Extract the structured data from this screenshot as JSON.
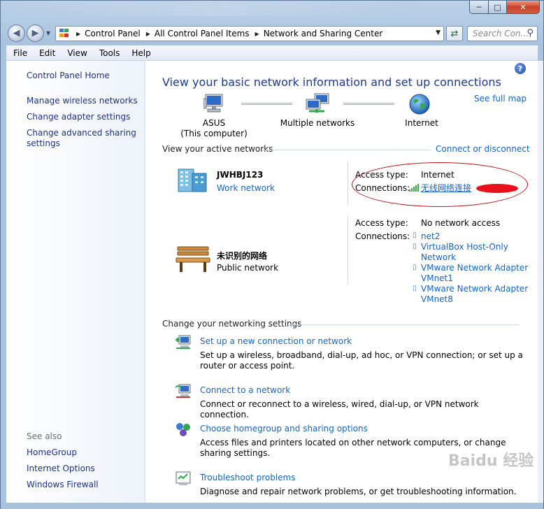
{
  "address": {
    "crumbs": [
      "Control Panel",
      "All Control Panel Items",
      "Network and Sharing Center"
    ],
    "search_placeholder": "Search Con..."
  },
  "menu": [
    "File",
    "Edit",
    "View",
    "Tools",
    "Help"
  ],
  "sidebar": {
    "home": "Control Panel Home",
    "links": [
      "Manage wireless networks",
      "Change adapter settings",
      "Change advanced sharing settings"
    ],
    "see_also_title": "See also",
    "see_also": [
      "HomeGroup",
      "Internet Options",
      "Windows Firewall"
    ]
  },
  "main": {
    "heading": "View your basic network information and set up connections",
    "see_full_map": "See full map",
    "map": {
      "computer_name": "ASUS",
      "computer_note": "(This computer)",
      "middle": "Multiple networks",
      "internet": "Internet"
    },
    "active_title": "View your active networks",
    "connect_or_disconnect": "Connect or disconnect",
    "networks": [
      {
        "name": "JWHBJ123",
        "type": "Work network",
        "access_label": "Access type:",
        "access_value": "Internet",
        "connections_label": "Connections:",
        "connections": [
          "无线网络连接"
        ]
      },
      {
        "name": "未识别的网络",
        "type": "Public network",
        "access_label": "Access type:",
        "access_value": "No network access",
        "connections_label": "Connections:",
        "connections": [
          "net2",
          "VirtualBox Host-Only Network",
          "VMware Network Adapter VMnet1",
          "VMware Network Adapter VMnet8"
        ]
      }
    ],
    "change_title": "Change your networking settings",
    "tasks": [
      {
        "link": "Set up a new connection or network",
        "desc": "Set up a wireless, broadband, dial-up, ad hoc, or VPN connection; or set up a router or access point."
      },
      {
        "link": "Connect to a network",
        "desc": "Connect or reconnect to a wireless, wired, dial-up, or VPN network connection."
      },
      {
        "link": "Choose homegroup and sharing options",
        "desc": "Access files and printers located on other network computers, or change sharing settings."
      },
      {
        "link": "Troubleshoot problems",
        "desc": "Diagnose and repair network problems, or get troubleshooting information."
      }
    ]
  },
  "watermark": "Baidu 经验",
  "colors": {
    "link": "#1565c0",
    "heading": "#1e3a8a",
    "annotation": "#c0141a"
  }
}
